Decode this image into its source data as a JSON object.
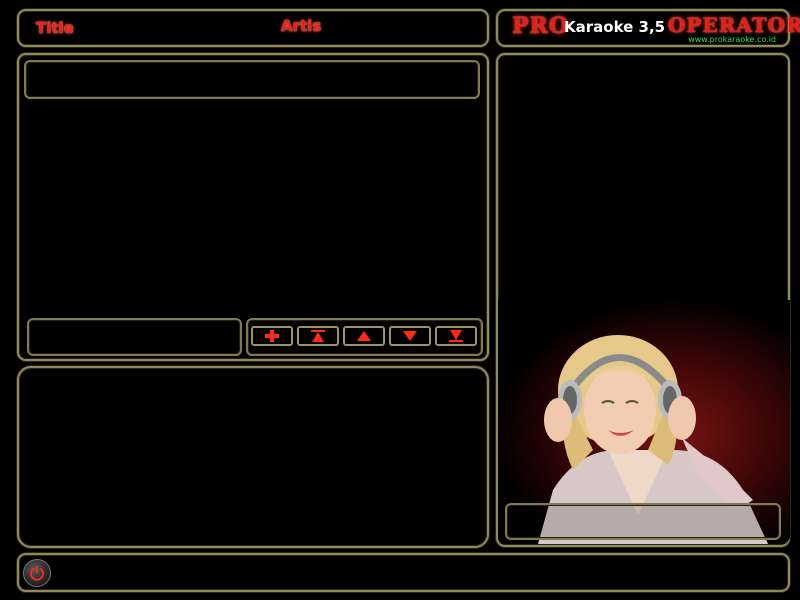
{
  "header": {
    "title_label": "Title",
    "artist_label": "Artis"
  },
  "logo": {
    "pro": "PRO",
    "name": "Karaoke 3,5",
    "operator": "OPERATOR",
    "url": "www.prokaraoke.co.id"
  },
  "search": {
    "value": ""
  },
  "playlist": {
    "status_text": "",
    "controls": [
      {
        "name": "add",
        "icon": "plus-icon"
      },
      {
        "name": "move-top",
        "icon": "move-top-icon"
      },
      {
        "name": "move-up",
        "icon": "arrow-up-icon"
      },
      {
        "name": "move-down",
        "icon": "arrow-down-icon"
      },
      {
        "name": "move-bottom",
        "icon": "move-bottom-icon"
      }
    ]
  },
  "preview": {
    "caption": ""
  },
  "footer": {
    "power_icon": "power-icon"
  },
  "colors": {
    "accent_red": "#e8241a",
    "border_olive": "#8f8a5c",
    "url_green": "#39d94a",
    "background": "#000000"
  }
}
